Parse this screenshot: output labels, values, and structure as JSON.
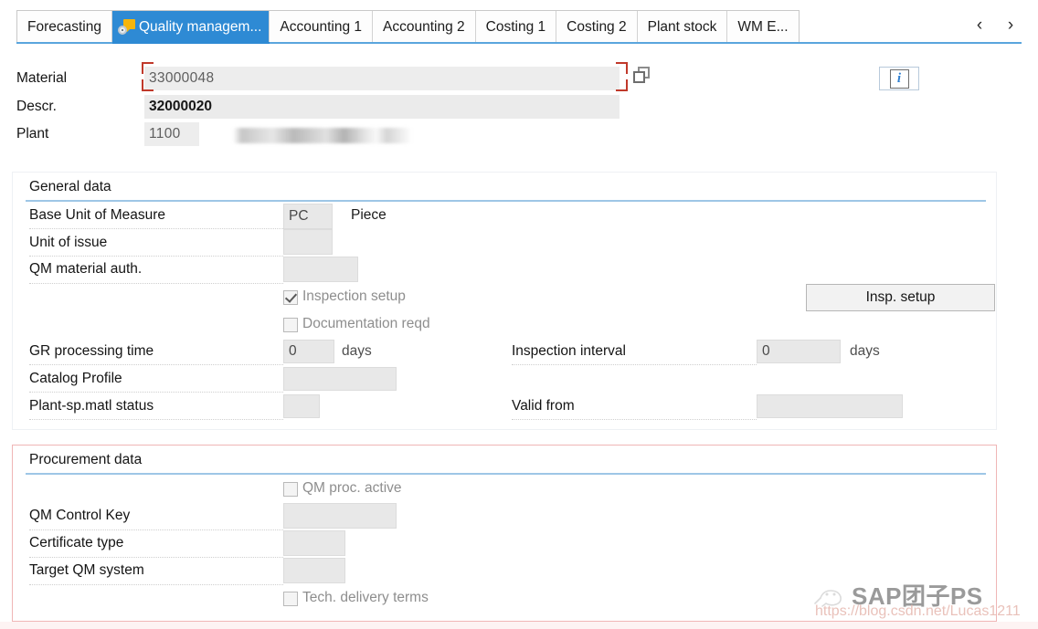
{
  "tabbar": {
    "tabs": [
      {
        "label": "Forecasting",
        "active": false,
        "icon": null
      },
      {
        "label": "Quality managem...",
        "active": true,
        "icon": "quality-management-icon"
      },
      {
        "label": "Accounting 1",
        "active": false,
        "icon": null
      },
      {
        "label": "Accounting 2",
        "active": false,
        "icon": null
      },
      {
        "label": "Costing 1",
        "active": false,
        "icon": null
      },
      {
        "label": "Costing 2",
        "active": false,
        "icon": null
      },
      {
        "label": "Plant stock",
        "active": false,
        "icon": null
      },
      {
        "label": "WM E...",
        "active": false,
        "icon": null
      }
    ],
    "prev_label": "‹",
    "next_label": "›",
    "active_color": "#2e8ad4",
    "underline_color": "#5aa5dd"
  },
  "header": {
    "material": {
      "label": "Material",
      "value": "33000048",
      "focused": true
    },
    "descr": {
      "label": "Descr.",
      "value": "32000020"
    },
    "plant": {
      "label": "Plant",
      "value": "1100",
      "description_redacted": true
    },
    "copy_icon": "copy-icon",
    "info_icon": "info-icon",
    "focus_color": "#c0392b"
  },
  "general_data": {
    "title": "General data",
    "fields": {
      "base_unit_of_measure": {
        "label": "Base Unit of Measure",
        "value": "PC",
        "text": "Piece"
      },
      "unit_of_issue": {
        "label": "Unit of issue",
        "value": ""
      },
      "qm_material_auth": {
        "label": "QM material auth.",
        "value": ""
      },
      "gr_processing_time": {
        "label": "GR processing time",
        "value": "0",
        "unit": "days"
      },
      "catalog_profile": {
        "label": "Catalog Profile",
        "value": ""
      },
      "plant_sp_matl_status": {
        "label": "Plant-sp.matl status",
        "value": ""
      },
      "inspection_interval": {
        "label": "Inspection interval",
        "value": "0",
        "unit": "days"
      },
      "valid_from": {
        "label": "Valid from",
        "value": ""
      }
    },
    "checkboxes": [
      {
        "label": "Inspection setup",
        "checked": true,
        "disabled": true
      },
      {
        "label": "Documentation reqd",
        "checked": false,
        "disabled": true
      }
    ],
    "buttons": {
      "insp_setup": "Insp. setup"
    }
  },
  "procurement_data": {
    "title": "Procurement data",
    "border_color": "#f0b6b6",
    "fields": {
      "qm_control_key": {
        "label": "QM Control Key",
        "value": ""
      },
      "certificate_type": {
        "label": "Certificate type",
        "value": ""
      },
      "target_qm_system": {
        "label": "Target QM system",
        "value": ""
      }
    },
    "checkboxes": [
      {
        "label": "QM proc. active",
        "checked": false,
        "disabled": true
      },
      {
        "label": "Tech. delivery terms",
        "checked": false,
        "disabled": true
      }
    ]
  },
  "watermark": {
    "text": "SAP团子PS",
    "url": "https://blog.csdn.net/Lucas1211"
  }
}
